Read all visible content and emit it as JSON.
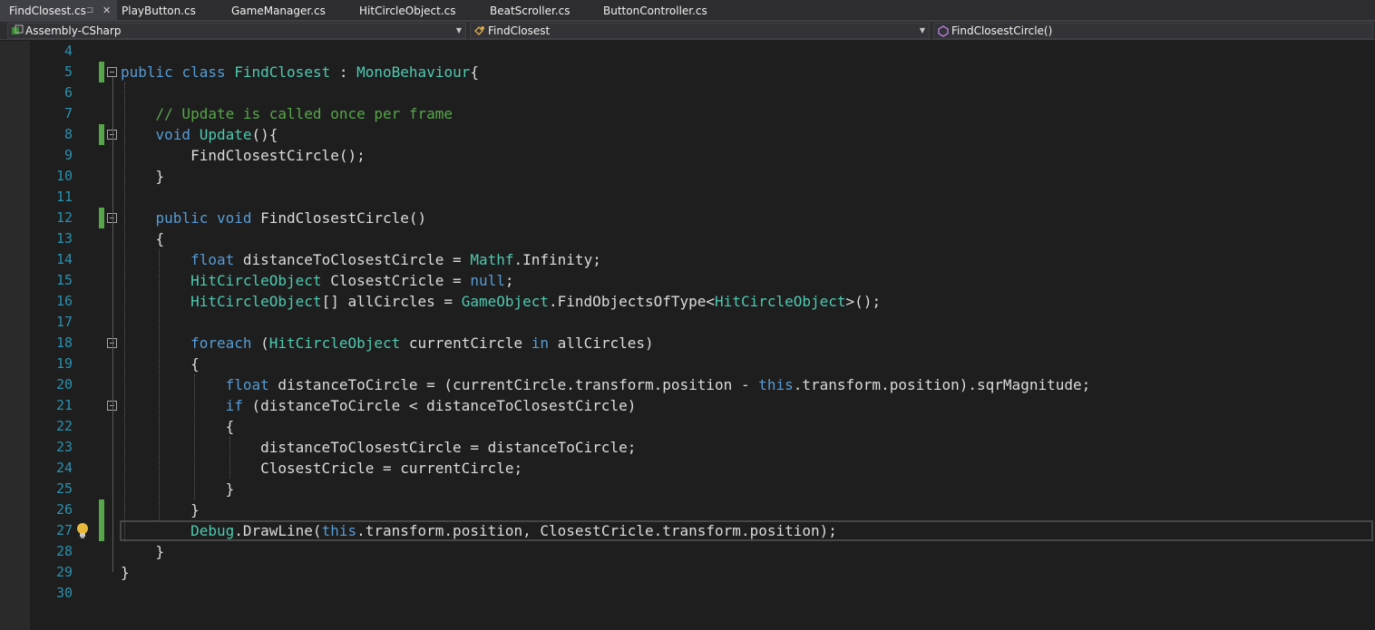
{
  "tabs": [
    {
      "label": "FindClosest.cs",
      "active": true,
      "pin": "⊐",
      "close": "✕"
    },
    {
      "label": "PlayButton.cs"
    },
    {
      "label": "GameManager.cs"
    },
    {
      "label": "HitCircleObject.cs"
    },
    {
      "label": "BeatScroller.cs"
    },
    {
      "label": "ButtonController.cs"
    }
  ],
  "navbar": {
    "project": "Assembly-CSharp",
    "type": "FindClosest",
    "member": "FindClosestCircle()",
    "project_icon": "csharp-project-icon",
    "type_icon": "class-icon",
    "member_icon": "method-icon"
  },
  "editor": {
    "current_line": 27,
    "lightbulb_line": 27,
    "changed_lines": [
      5,
      8,
      12,
      26,
      27
    ],
    "fold_lines": [
      5,
      8,
      12,
      18,
      21
    ],
    "lines": [
      {
        "n": "4",
        "tokens": []
      },
      {
        "n": "5",
        "tokens": [
          [
            "k",
            "public"
          ],
          [
            "p",
            " "
          ],
          [
            "k",
            "class"
          ],
          [
            "p",
            " "
          ],
          [
            "t",
            "FindClosest"
          ],
          [
            "p",
            " : "
          ],
          [
            "t",
            "MonoBehaviour"
          ],
          [
            "p",
            "{"
          ]
        ]
      },
      {
        "n": "6",
        "tokens": []
      },
      {
        "n": "7",
        "tokens": [
          [
            "p",
            "    "
          ],
          [
            "c",
            "// Update is called once per frame"
          ]
        ]
      },
      {
        "n": "8",
        "tokens": [
          [
            "p",
            "    "
          ],
          [
            "k",
            "void"
          ],
          [
            "p",
            " "
          ],
          [
            "t",
            "Update"
          ],
          [
            "p",
            "(){"
          ]
        ]
      },
      {
        "n": "9",
        "tokens": [
          [
            "p",
            "        FindClosestCircle();"
          ]
        ]
      },
      {
        "n": "10",
        "tokens": [
          [
            "p",
            "    }"
          ]
        ]
      },
      {
        "n": "11",
        "tokens": []
      },
      {
        "n": "12",
        "tokens": [
          [
            "p",
            "    "
          ],
          [
            "k",
            "public"
          ],
          [
            "p",
            " "
          ],
          [
            "k",
            "void"
          ],
          [
            "p",
            " FindClosestCircle()"
          ]
        ]
      },
      {
        "n": "13",
        "tokens": [
          [
            "p",
            "    {"
          ]
        ]
      },
      {
        "n": "14",
        "tokens": [
          [
            "p",
            "        "
          ],
          [
            "k",
            "float"
          ],
          [
            "p",
            " distanceToClosestCircle = "
          ],
          [
            "t",
            "Mathf"
          ],
          [
            "p",
            ".Infinity;"
          ]
        ]
      },
      {
        "n": "15",
        "tokens": [
          [
            "p",
            "        "
          ],
          [
            "t",
            "HitCircleObject"
          ],
          [
            "p",
            " ClosestCricle = "
          ],
          [
            "k",
            "null"
          ],
          [
            "p",
            ";"
          ]
        ]
      },
      {
        "n": "16",
        "tokens": [
          [
            "p",
            "        "
          ],
          [
            "t",
            "HitCircleObject"
          ],
          [
            "p",
            "[] allCircles = "
          ],
          [
            "t",
            "GameObject"
          ],
          [
            "p",
            ".FindObjectsOfType<"
          ],
          [
            "t",
            "HitCircleObject"
          ],
          [
            "p",
            ">();"
          ]
        ]
      },
      {
        "n": "17",
        "tokens": []
      },
      {
        "n": "18",
        "tokens": [
          [
            "p",
            "        "
          ],
          [
            "k",
            "foreach"
          ],
          [
            "p",
            " ("
          ],
          [
            "t",
            "HitCircleObject"
          ],
          [
            "p",
            " currentCircle "
          ],
          [
            "k",
            "in"
          ],
          [
            "p",
            " allCircles)"
          ]
        ]
      },
      {
        "n": "19",
        "tokens": [
          [
            "p",
            "        {"
          ]
        ]
      },
      {
        "n": "20",
        "tokens": [
          [
            "p",
            "            "
          ],
          [
            "k",
            "float"
          ],
          [
            "p",
            " distanceToCircle = (currentCircle.transform.position - "
          ],
          [
            "k",
            "this"
          ],
          [
            "p",
            ".transform.position).sqrMagnitude;"
          ]
        ]
      },
      {
        "n": "21",
        "tokens": [
          [
            "p",
            "            "
          ],
          [
            "k",
            "if"
          ],
          [
            "p",
            " (distanceToCircle < distanceToClosestCircle)"
          ]
        ]
      },
      {
        "n": "22",
        "tokens": [
          [
            "p",
            "            {"
          ]
        ]
      },
      {
        "n": "23",
        "tokens": [
          [
            "p",
            "                distanceToClosestCircle = distanceToCircle;"
          ]
        ]
      },
      {
        "n": "24",
        "tokens": [
          [
            "p",
            "                ClosestCricle = currentCircle;"
          ]
        ]
      },
      {
        "n": "25",
        "tokens": [
          [
            "p",
            "            }"
          ]
        ]
      },
      {
        "n": "26",
        "tokens": [
          [
            "p",
            "        }"
          ]
        ]
      },
      {
        "n": "27",
        "tokens": [
          [
            "p",
            "        "
          ],
          [
            "t",
            "Debug"
          ],
          [
            "p",
            ".DrawLine("
          ],
          [
            "k",
            "this"
          ],
          [
            "p",
            ".transform.position, ClosestCricle.transform.position);"
          ]
        ]
      },
      {
        "n": "28",
        "tokens": [
          [
            "p",
            "    }"
          ]
        ]
      },
      {
        "n": "29",
        "tokens": [
          [
            "p",
            "}"
          ]
        ]
      },
      {
        "n": "30",
        "tokens": []
      }
    ]
  }
}
